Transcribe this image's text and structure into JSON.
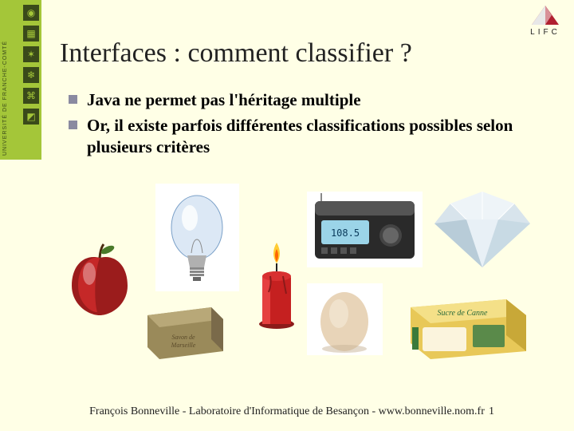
{
  "sidebar": {
    "university": "UNIVERSITÉ DE FRANCHE-COMTÉ"
  },
  "logo": {
    "text": "LIFC"
  },
  "title": "Interfaces : comment classifier ?",
  "bullets": [
    "Java ne permet pas l'héritage multiple",
    "Or, il existe parfois différentes classifications possibles selon plusieurs critères"
  ],
  "images": {
    "apple": "apple",
    "lightbulb": "lightbulb",
    "candle": "candle",
    "radio": "radio",
    "diamond": "diamond",
    "soap": "soap",
    "egg": "egg",
    "sugar": "sugar"
  },
  "footer": "François Bonneville - Laboratoire d'Informatique de Besançon - www.bonneville.nom.fr",
  "page": "1"
}
